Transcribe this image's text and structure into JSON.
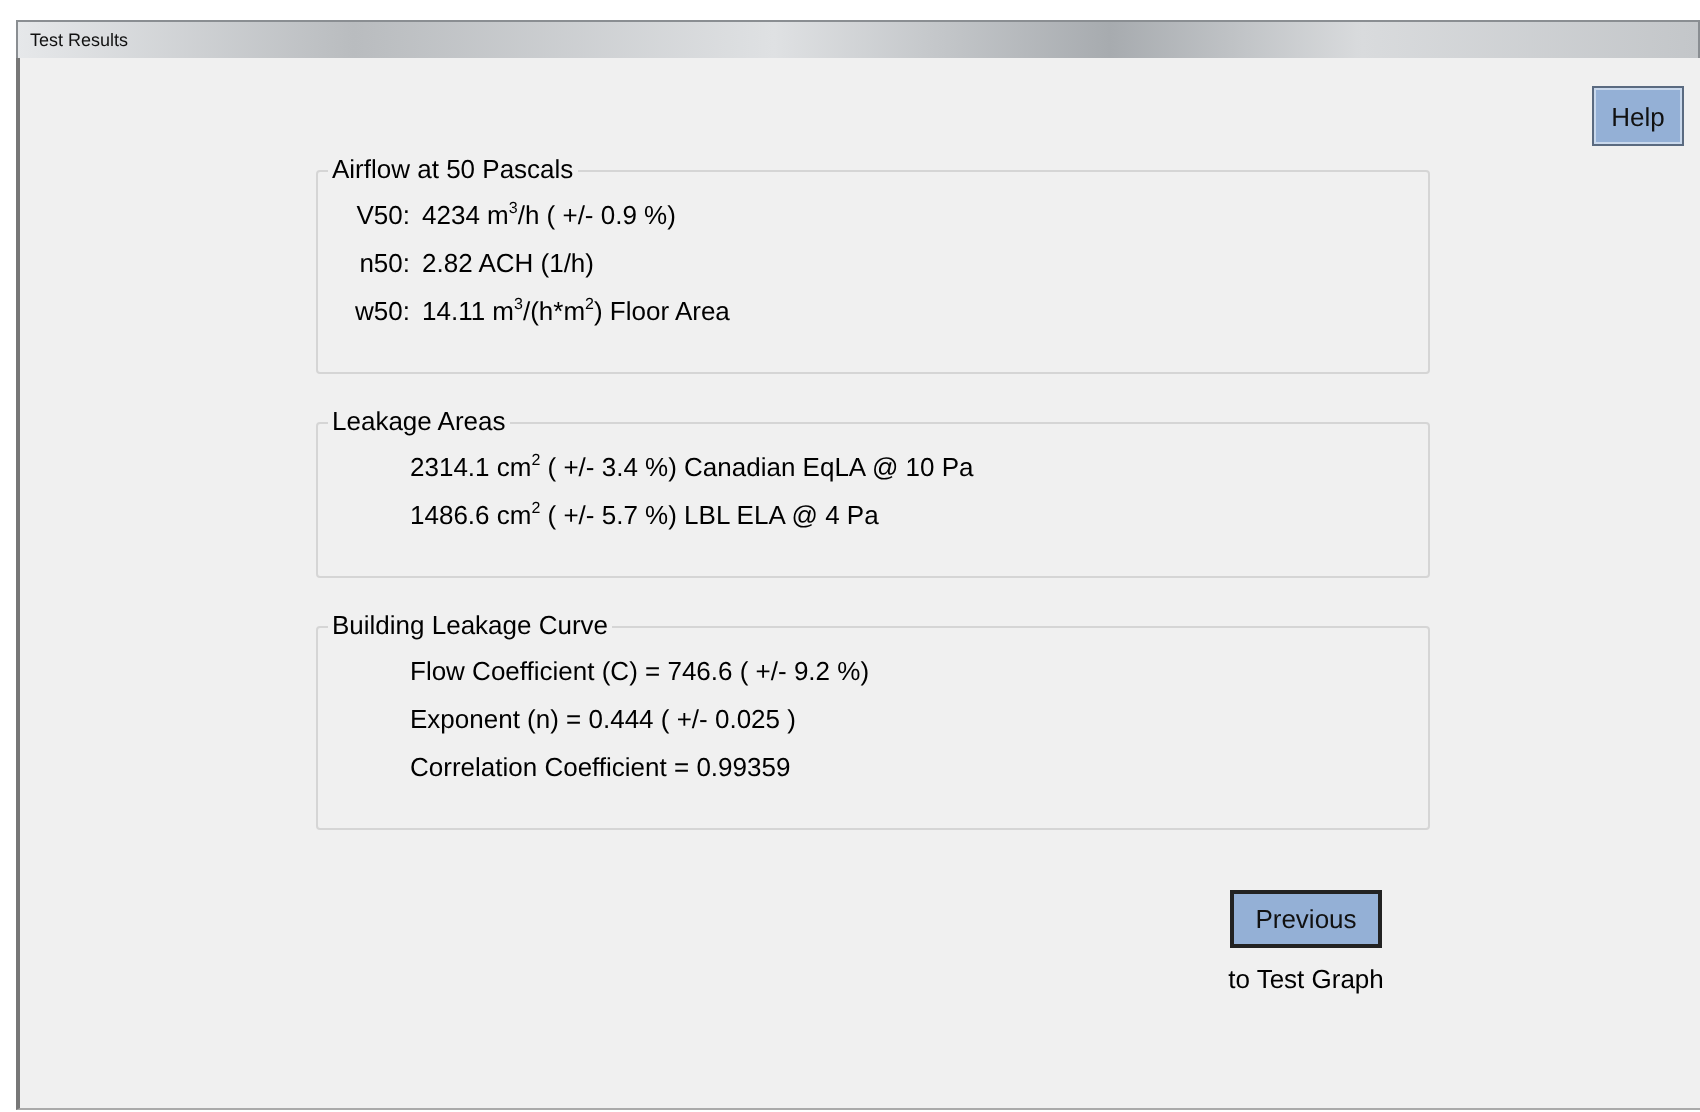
{
  "window": {
    "title": "Test Results"
  },
  "help_button": {
    "label": "Help"
  },
  "groups": [
    {
      "title": "Airflow at 50 Pascals",
      "kind": "labeled",
      "rows": [
        {
          "label": "V50:",
          "value": "4234 m$^{3}$/h ( +/- 0.9 %)"
        },
        {
          "label": "n50:",
          "value": "2.82 ACH (1/h)"
        },
        {
          "label": "w50:",
          "value": "14.11 m$^{3}$/(h*m$^{2}$) Floor Area"
        }
      ]
    },
    {
      "title": "Leakage Areas",
      "kind": "plain",
      "rows": [
        {
          "value": "2314.1 cm$^{2}$ ( +/- 3.4 %) Canadian EqLA @ 10 Pa"
        },
        {
          "value": "1486.6 cm$^{2}$ ( +/- 5.7 %) LBL ELA @ 4 Pa"
        }
      ]
    },
    {
      "title": "Building Leakage Curve",
      "kind": "plain",
      "rows": [
        {
          "value": "Flow Coefficient (C) = 746.6  ( +/- 9.2 %)"
        },
        {
          "value": "Exponent (n) = 0.444 ( +/- 0.025 )"
        },
        {
          "value": "Correlation Coefficient = 0.99359"
        }
      ]
    }
  ],
  "previous_button": {
    "label": "Previous",
    "caption": "to Test Graph"
  }
}
